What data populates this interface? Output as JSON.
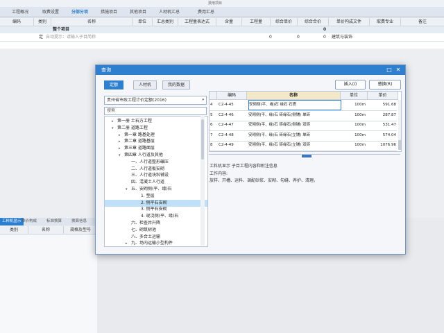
{
  "window_title": "费用项目",
  "app_tabs": [
    "工程概况",
    "取费设置",
    "分部分项",
    "措施项目",
    "其他项目",
    "人材机汇总",
    "费用汇总"
  ],
  "main_grid": {
    "headers": [
      "编码",
      "类别",
      "名称",
      "单位",
      "汇总类别",
      "工程量表达式",
      "含量",
      "工程量",
      "综合单价",
      "综合合价",
      "单价构成文件",
      "取费专业",
      "备注"
    ],
    "rows": [
      {
        "name": "整个项目",
        "total": "0"
      },
      {
        "type": "定",
        "name_placeholder": "自动提示：请输入子目简称",
        "quantity": "0",
        "unit_price": "0",
        "total": "0",
        "price_file": "建筑与装饰"
      }
    ]
  },
  "lower_tabs": [
    "工料机显示",
    "单价构成",
    "标准换算",
    "换算信息"
  ],
  "lower_grid_headers": [
    "类别",
    "名称",
    "规格及型号"
  ],
  "dialog": {
    "title": "查询",
    "tabs": [
      "定额",
      "人材机",
      "我的数据"
    ],
    "active_tab": "定额",
    "insert_button": "插入(I)",
    "replace_button": "替换(R)",
    "library": "贵州省市政工程计价定额(2016)",
    "search_placeholder": "搜索",
    "tree": [
      {
        "label": "第一册 土石方工程",
        "level": 0,
        "toggle": "▸"
      },
      {
        "label": "第二册 道路工程",
        "level": 0,
        "toggle": "▾"
      },
      {
        "label": "第一章 路基处理",
        "level": 1,
        "toggle": "▸"
      },
      {
        "label": "第二章 道路基层",
        "level": 1,
        "toggle": "▸"
      },
      {
        "label": "第三章 道路面层",
        "level": 1,
        "toggle": "▸"
      },
      {
        "label": "第四章 人行道及其他",
        "level": 1,
        "toggle": "▾"
      },
      {
        "label": "一、人行道整形碾压",
        "level": 2,
        "toggle": ""
      },
      {
        "label": "二、人行道板安砌",
        "level": 2,
        "toggle": ""
      },
      {
        "label": "三、人行道块料铺设",
        "level": 2,
        "toggle": ""
      },
      {
        "label": "四、混凝土人行道",
        "level": 2,
        "toggle": ""
      },
      {
        "label": "五、安砌侧(平、缘)石",
        "level": 2,
        "toggle": "▾"
      },
      {
        "label": "1. 垫层",
        "level": 3,
        "toggle": ""
      },
      {
        "label": "2. 侧平石安砌",
        "level": 3,
        "toggle": "",
        "selected": true
      },
      {
        "label": "3. 侧平石安砌",
        "level": 3,
        "toggle": ""
      },
      {
        "label": "4. 现浇侧(平、缘)石",
        "level": 3,
        "toggle": ""
      },
      {
        "label": "六、检查井升降",
        "level": 2,
        "toggle": ""
      },
      {
        "label": "七、砌筑树池",
        "level": 2,
        "toggle": ""
      },
      {
        "label": "八、多合土运输",
        "level": 2,
        "toggle": ""
      },
      {
        "label": "九、场内运输小型构件",
        "level": 2,
        "toggle": "▸"
      }
    ],
    "quota_table": {
      "headers": [
        "编码",
        "名称",
        "单位",
        "单价"
      ],
      "rows": [
        {
          "idx": "4",
          "code": "C2-4-45",
          "name": "安砌侧(平、缘)石 缘石 石质",
          "unit": "100m",
          "price": "591.68",
          "current": true
        },
        {
          "idx": "5",
          "code": "C2-4-46",
          "name": "安砌侧(平、缘)石 砖缘石(侧铺) 单砖",
          "unit": "100m",
          "price": "287.87"
        },
        {
          "idx": "6",
          "code": "C2-4-47",
          "name": "安砌侧(平、缘)石 砖缘石(侧铺) 双砖",
          "unit": "100m",
          "price": "531.47"
        },
        {
          "idx": "7",
          "code": "C2-4-48",
          "name": "安砌侧(平、缘)石 砖缘石(立铺) 单砖",
          "unit": "100m",
          "price": "574.04"
        },
        {
          "idx": "8",
          "code": "C2-4-49",
          "name": "安砌侧(平、缘)石 砖缘石(立铺) 双砖",
          "unit": "100m",
          "price": "1076.96"
        }
      ]
    },
    "info_title": "工料机显示  子目工程内容和附注信息",
    "work_label": "工作内容:",
    "work_text": "放样、开槽、运料、调配砂浆、安砌、勾缝、养护、清理。"
  }
}
